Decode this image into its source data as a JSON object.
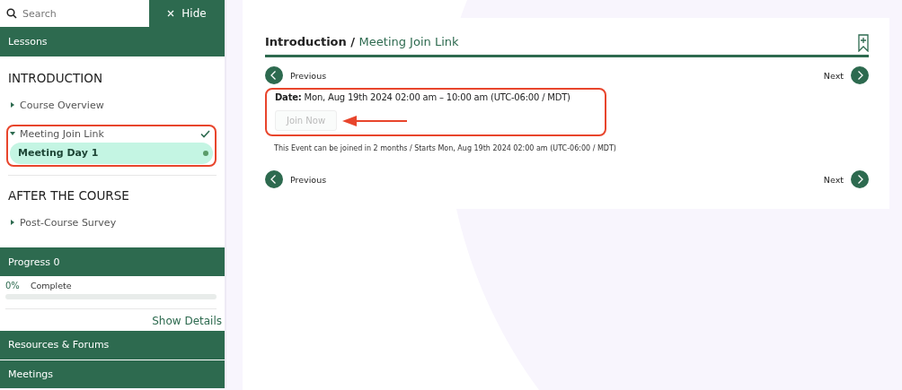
{
  "sidebar": {
    "search": {
      "placeholder": "Search"
    },
    "hide_button": "Hide",
    "lessons_header": "Lessons",
    "sections": [
      {
        "title": "INTRODUCTION",
        "items": [
          {
            "label": "Course Overview",
            "expanded": false,
            "completed": false,
            "highlighted": false
          },
          {
            "label": "Meeting Join Link",
            "expanded": true,
            "completed": true,
            "highlighted": true,
            "children": [
              {
                "label": "Meeting Day 1",
                "selected": true
              }
            ]
          }
        ]
      },
      {
        "title": "AFTER THE COURSE",
        "items": [
          {
            "label": "Post-Course Survey",
            "expanded": false,
            "completed": false,
            "highlighted": false
          }
        ]
      }
    ],
    "progress": {
      "header": "Progress 0",
      "percent": "0%",
      "label": "Complete",
      "level": 0,
      "details_link": "Show Details"
    },
    "panels": [
      "Resources & Forums",
      "Meetings"
    ]
  },
  "content": {
    "breadcrumb": {
      "parent": "Introduction",
      "separator": "/",
      "current": "Meeting Join Link"
    },
    "nav_top": {
      "previous": "Previous",
      "next": "Next"
    },
    "event": {
      "highlighted": true,
      "date_label": "Date:",
      "date_value": "Mon, Aug 19th 2024 02:00 am – 10:00 am (UTC-06:00 / MDT)",
      "join_button": {
        "label": "Join Now",
        "disabled": true
      },
      "pointer_arrow": true,
      "note": "This Event can be joined in 2 months / Starts Mon, Aug 19th 2024 02:00 am (UTC-06:00 / MDT)"
    },
    "nav_bottom": {
      "previous": "Previous",
      "next": "Next"
    }
  }
}
